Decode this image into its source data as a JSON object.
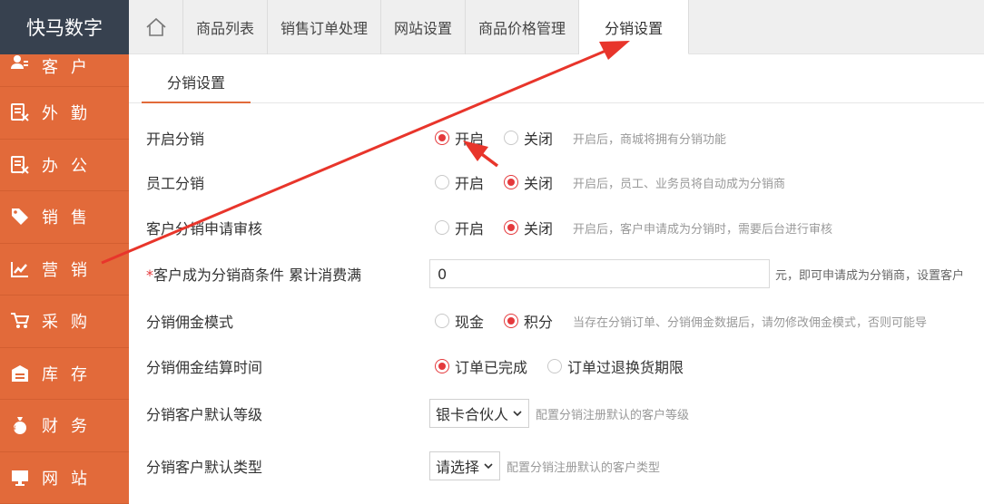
{
  "brand": "快马数字",
  "sidebar": {
    "items": [
      {
        "label": "客户",
        "icon": "user-icon"
      },
      {
        "label": "外勤",
        "icon": "clipboard-icon"
      },
      {
        "label": "办公",
        "icon": "clipboard-icon"
      },
      {
        "label": "销售",
        "icon": "tag-icon"
      },
      {
        "label": "营销",
        "icon": "chart-icon"
      },
      {
        "label": "采购",
        "icon": "cart-icon"
      },
      {
        "label": "库存",
        "icon": "warehouse-icon"
      },
      {
        "label": "财务",
        "icon": "money-icon"
      },
      {
        "label": "网站",
        "icon": "monitor-icon"
      }
    ]
  },
  "tabs": [
    "商品列表",
    "销售订单处理",
    "网站设置",
    "商品价格管理",
    "分销设置"
  ],
  "subtab": "分销设置",
  "form": {
    "enable_dist": {
      "label": "开启分销",
      "opt1": "开启",
      "opt2": "关闭",
      "selected": "开启",
      "hint": "开启后，商城将拥有分销功能"
    },
    "staff_dist": {
      "label": "员工分销",
      "opt1": "开启",
      "opt2": "关闭",
      "selected": "关闭",
      "hint": "开启后，员工、业务员将自动成为分销商"
    },
    "customer_review": {
      "label": "客户分销申请审核",
      "opt1": "开启",
      "opt2": "关闭",
      "selected": "关闭",
      "hint": "开启后，客户申请成为分销时，需要后台进行审核"
    },
    "condition": {
      "required_mark": "*",
      "label": "客户成为分销商条件 累计消费满",
      "value": "0",
      "after": "元，即可申请成为分销商，设置客户"
    },
    "commission_mode": {
      "label": "分销佣金模式",
      "opt1": "现金",
      "opt2": "积分",
      "selected": "积分",
      "hint": "当存在分销订单、分销佣金数据后，请勿修改佣金模式，否则可能导"
    },
    "settle_time": {
      "label": "分销佣金结算时间",
      "opt1": "订单已完成",
      "opt2": "订单过退换货期限",
      "selected": "订单已完成"
    },
    "default_level": {
      "label": "分销客户默认等级",
      "value": "银卡合伙人",
      "hint": "配置分销注册默认的客户等级"
    },
    "default_type": {
      "label": "分销客户默认类型",
      "value": "请选择",
      "hint": "配置分销注册默认的客户类型"
    }
  },
  "colors": {
    "sidebar": "#e26a3a",
    "brand_bg": "#37414f",
    "radio_on": "#e4393c",
    "annotation_arrow": "#e8352b"
  }
}
